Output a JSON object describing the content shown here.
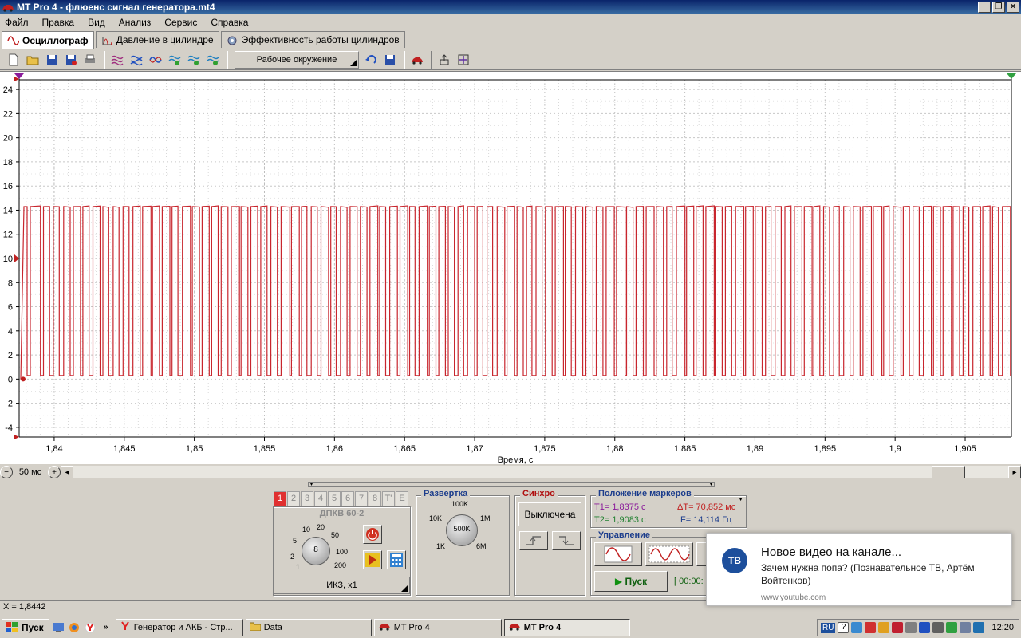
{
  "window": {
    "title": "MT Pro 4 - флюенс сигнал генератора.mt4"
  },
  "menu": [
    "Файл",
    "Правка",
    "Вид",
    "Анализ",
    "Сервис",
    "Справка"
  ],
  "tabs": [
    {
      "label": "Осциллограф",
      "active": true,
      "icon": "sine-wave-icon"
    },
    {
      "label": "Давление в цилиндре",
      "active": false,
      "icon": "pressure-chart-icon"
    },
    {
      "label": "Эффективность работы цилиндров",
      "active": false,
      "icon": "gear-chart-icon"
    }
  ],
  "toolbar": {
    "environment_label": "Рабочее окружение",
    "buttons": [
      "new-file-icon",
      "open-folder-icon",
      "save-icon",
      "save-as-icon",
      "print-icon",
      "waves-1-icon",
      "waves-2-icon",
      "waves-3-icon",
      "waves-4-icon",
      "waves-5-icon",
      "waves-6-icon",
      "undo-icon",
      "save-env-icon",
      "car-icon",
      "export-icon",
      "fit-icon"
    ]
  },
  "chart_data": {
    "type": "line",
    "xlabel": "Время, с",
    "x_ticks": [
      "1,84",
      "1,845",
      "1,85",
      "1,855",
      "1,86",
      "1,865",
      "1,87",
      "1,875",
      "1,88",
      "1,885",
      "1,89",
      "1,895",
      "1,9",
      "1,905"
    ],
    "y_ticks": [
      "24",
      "22",
      "20",
      "18",
      "16",
      "14",
      "12",
      "10",
      "8",
      "6",
      "4",
      "2",
      "0",
      "-2",
      "-4"
    ],
    "xlim": [
      1.8375,
      1.9083
    ],
    "ylim": [
      -4.8,
      24.8
    ],
    "grid": true,
    "series": [
      {
        "color": "#c8262e",
        "high": 14.3,
        "low": 0.3,
        "pulse_count": 100
      }
    ]
  },
  "scroll": {
    "scale_label": "50 мс"
  },
  "channel": {
    "tabs": [
      "1",
      "2",
      "3",
      "4",
      "5",
      "6",
      "7",
      "8",
      "T'",
      "E"
    ],
    "sensor": "ДПКВ 60-2",
    "knob_value": "8",
    "knob_labels": [
      "1",
      "2",
      "5",
      "10",
      "20",
      "50",
      "100",
      "200"
    ],
    "mode": "ИКЗ, х1"
  },
  "sweep": {
    "title": "Развертка",
    "value": "500K",
    "labels": [
      "100K",
      "10K",
      "1M",
      "1K",
      "6M"
    ]
  },
  "sync": {
    "title": "Синхро",
    "state": "Выключена"
  },
  "markers": {
    "title": "Положение маркеров",
    "t1": "T1= 1,8375 с",
    "t2": "T2= 1,9083 с",
    "dt": "ΔT= 70,852 мс",
    "f": "F= 14,114 Гц"
  },
  "control": {
    "title": "Управление",
    "start_label": "Пуск",
    "time_text": "[ 00:00:"
  },
  "status": {
    "x_readout": "X = 1,8442"
  },
  "taskbar": {
    "start_label": "Пуск",
    "tasks": [
      {
        "label": "Генератор и АКБ - Стр...",
        "icon": "yandex-icon",
        "pressed": false
      },
      {
        "label": "Data",
        "icon": "folder-icon",
        "pressed": false
      },
      {
        "label": "MT Pro 4",
        "icon": "car-icon",
        "pressed": false
      },
      {
        "label": "MT Pro 4",
        "icon": "car-icon",
        "pressed": true
      }
    ],
    "lang": "RU",
    "clock": "12:20"
  },
  "toast": {
    "channel_badge": "ТВ",
    "title": "Новое видео на канале...",
    "body": "Зачем нужна попа? (Познавательное ТВ, Артём Войтенков)",
    "source": "www.youtube.com"
  },
  "colors": {
    "signal": "#c8262e",
    "title_bar": "#0a246a",
    "face": "#d4d0c8"
  }
}
